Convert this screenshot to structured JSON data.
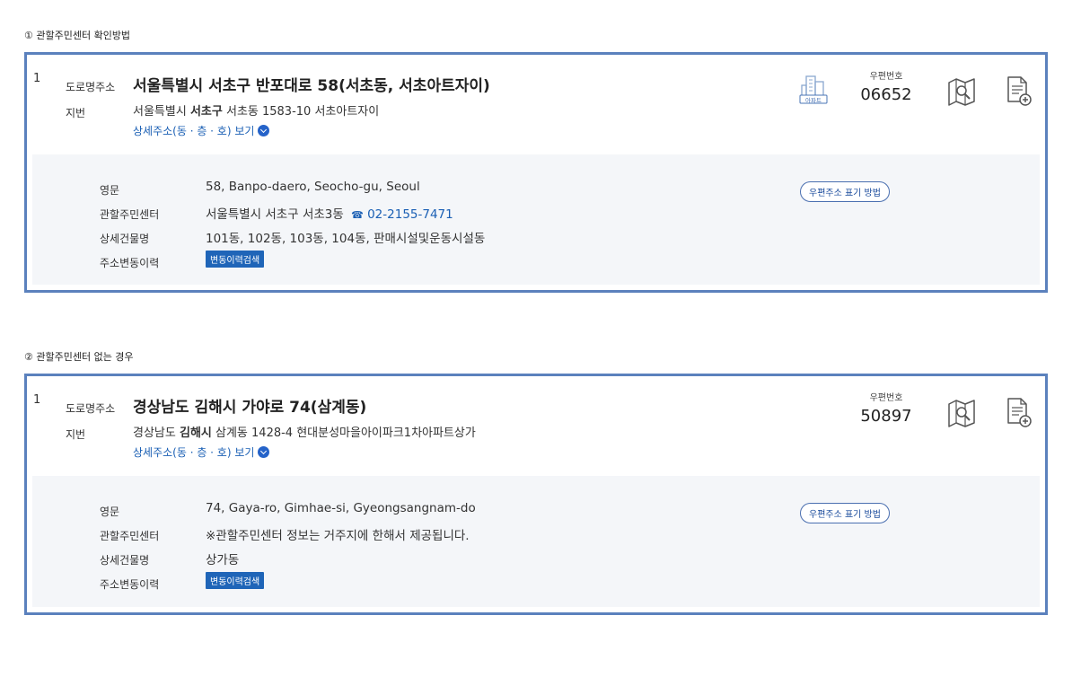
{
  "sections": [
    {
      "title": "① 관할주민센터 확인방법",
      "index": "1",
      "road_label": "도로명주소",
      "road_address": "서울특별시 서초구 반포대로 58(서초동, 서초아트자이)",
      "jibun_label": "지번",
      "jibun_prefix": "서울특별시",
      "jibun_bold": "서초구",
      "jibun_rest": "서초동 1583-10 서초아트자이",
      "detail_link": "상세주소(동 · 층 · 호) 보기",
      "building_icon_label": "아파트",
      "postal_label": "우편번호",
      "postal_code": "06652",
      "english_label": "영문",
      "english_value": "58, Banpo-daero, Seocho-gu, Seoul",
      "center_label": "관할주민센터",
      "center_value": "서울특별시 서초구 서초3동",
      "center_phone": "02-2155-7471",
      "building_name_label": "상세건물명",
      "building_name_value": "101동, 102동, 103동, 104동, 판매시설및운동시설동",
      "history_label": "주소변동이력",
      "history_button": "변동이력검색",
      "notation_button": "우편주소 표기 방법"
    },
    {
      "title": "② 관할주민센터 없는 경우",
      "index": "1",
      "road_label": "도로명주소",
      "road_address": "경상남도 김해시 가야로 74(삼계동)",
      "jibun_label": "지번",
      "jibun_prefix": "경상남도",
      "jibun_bold": "김해시",
      "jibun_rest": "삼계동 1428-4 현대분성마을아이파크1차아파트상가",
      "detail_link": "상세주소(동 · 층 · 호) 보기",
      "postal_label": "우편번호",
      "postal_code": "50897",
      "english_label": "영문",
      "english_value": "74, Gaya-ro, Gimhae-si, Gyeongsangnam-do",
      "center_label": "관할주민센터",
      "center_value": "※관할주민센터 정보는 거주지에 한해서 제공됩니다.",
      "building_name_label": "상세건물명",
      "building_name_value": "상가동",
      "history_label": "주소변동이력",
      "history_button": "변동이력검색",
      "notation_button": "우편주소 표기 방법"
    }
  ],
  "colors": {
    "border": "#5b81bd",
    "link": "#1a5fb4",
    "button": "#1f65b8",
    "panel_bg": "#f4f6f9"
  }
}
